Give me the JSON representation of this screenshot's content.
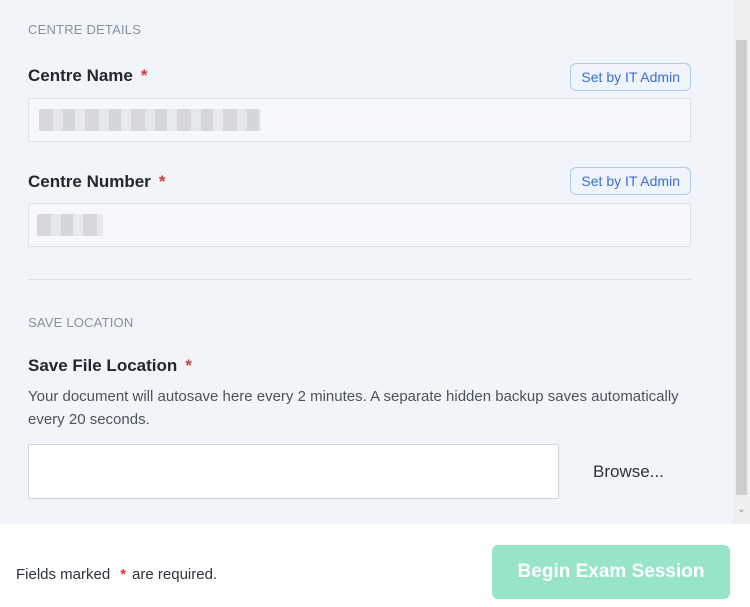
{
  "centre_details": {
    "section_title": "CENTRE DETAILS",
    "name_label": "Centre Name",
    "name_badge": "Set by IT Admin",
    "number_label": "Centre Number",
    "number_badge": "Set by IT Admin",
    "required_mark": "*"
  },
  "save_location": {
    "section_title": "SAVE LOCATION",
    "label": "Save File Location",
    "required_mark": "*",
    "help_text": "Your document will autosave here every 2 minutes. A separate hidden backup saves automatically every 20 seconds.",
    "path_value": "",
    "browse_label": "Browse..."
  },
  "footer": {
    "note_prefix": "Fields marked",
    "required_mark": "*",
    "note_suffix": "are required.",
    "begin_label": "Begin Exam Session",
    "begin_color": "#97e4c7"
  }
}
